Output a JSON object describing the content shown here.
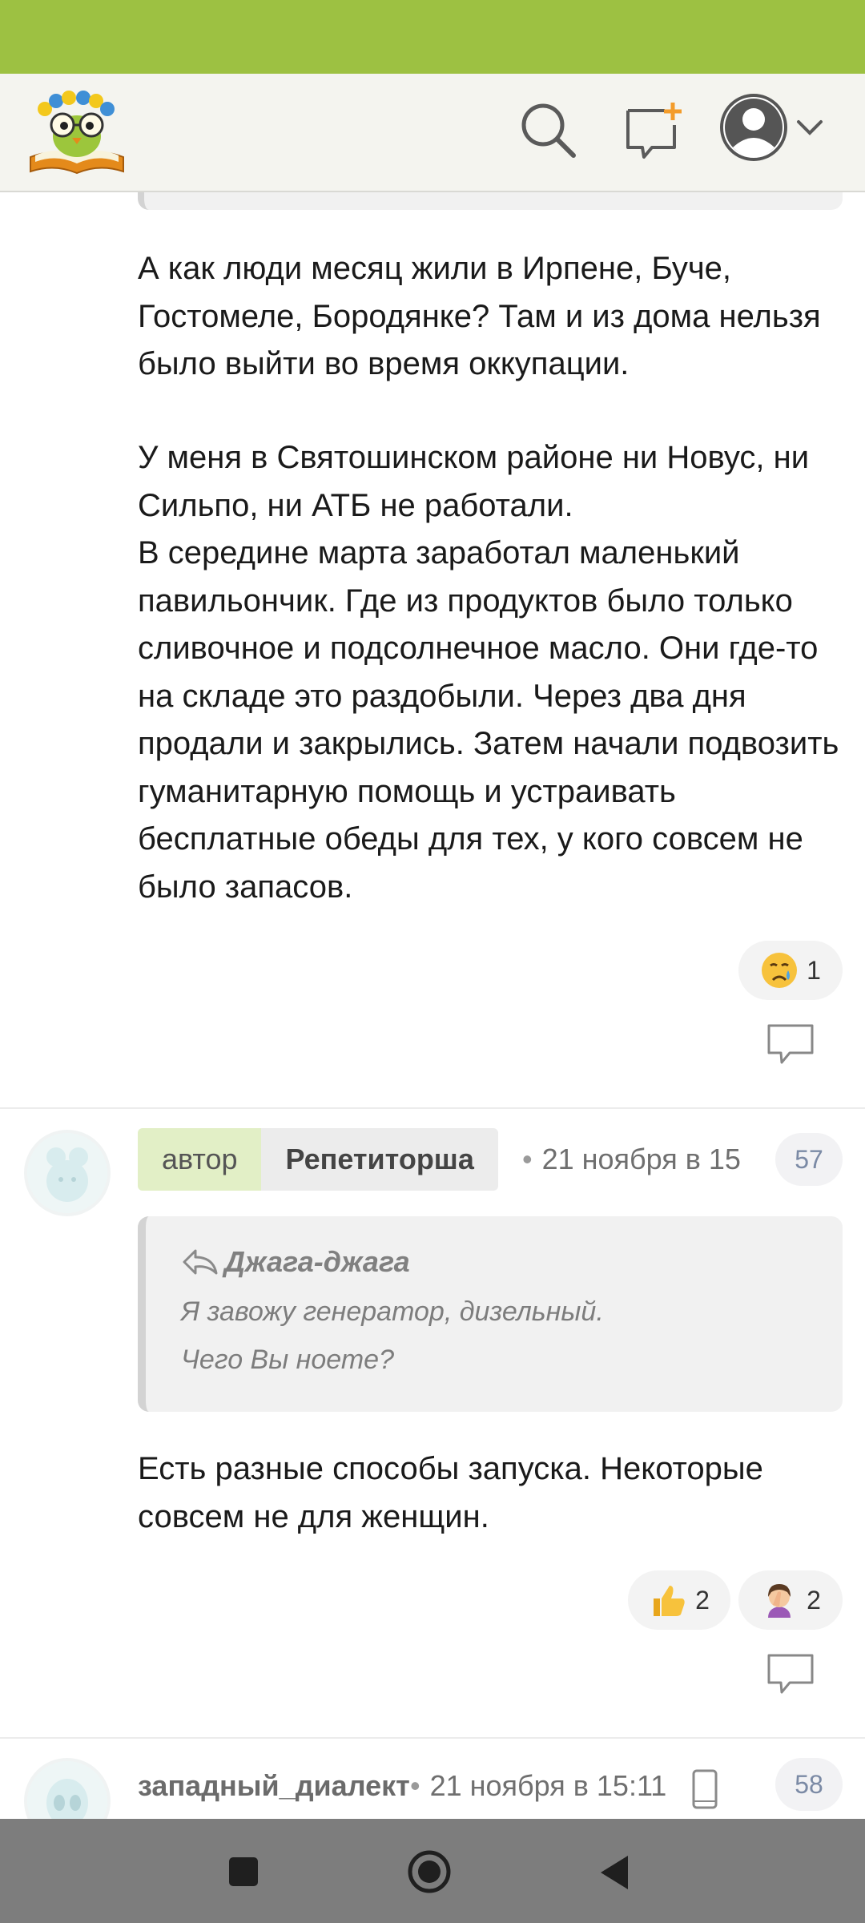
{
  "header": {
    "logo_icon": "owl-on-book-logo",
    "search_icon": "search-icon",
    "new_post_icon": "new-post-icon",
    "profile_icon": "profile-avatar-icon"
  },
  "post1": {
    "paragraph1": "А как люди месяц жили в Ирпене, Буче, Гостомеле, Бородянке? Там и из дома нельзя было выйти во время оккупации.",
    "paragraph2": "У меня в Святошинском районе ни Новус, ни Сильпо, ни АТБ не работали.",
    "paragraph3": "В середине марта заработал маленький павильончик. Где из продуктов было только сливочное и подсолнечное масло. Они где-то на складе это раздобыли. Через два дня продали и закрылись. Затем начали подвозить гуманитарную помощь и устраивать бесплатные обеды для тех, у кого совсем не было запасов.",
    "reactions": [
      {
        "emoji": "crying-face",
        "count": "1"
      }
    ]
  },
  "post2": {
    "role": "автор",
    "author": "Репетиторша",
    "date": "21 ноября в 15",
    "number": "57",
    "quote": {
      "author": "Джага-джага",
      "line1": "Я завожу генератор, дизельный.",
      "line2": "Чего Вы ноете?"
    },
    "text": "Есть разные способы запуска. Некоторые совсем не для женщин.",
    "reactions": [
      {
        "emoji": "thumbs-up",
        "count": "2"
      },
      {
        "emoji": "facepalm",
        "count": "2"
      }
    ]
  },
  "post3": {
    "author": "западный_диалект",
    "date": "21 ноября в 15:11",
    "device_icon": "mobile-phone-icon",
    "number": "58"
  },
  "colors": {
    "status_bar": "#9dc142",
    "header_bg": "#f4f4ef",
    "author_badge": "#e2efc6",
    "nav_bar": "#7d7d7d"
  }
}
